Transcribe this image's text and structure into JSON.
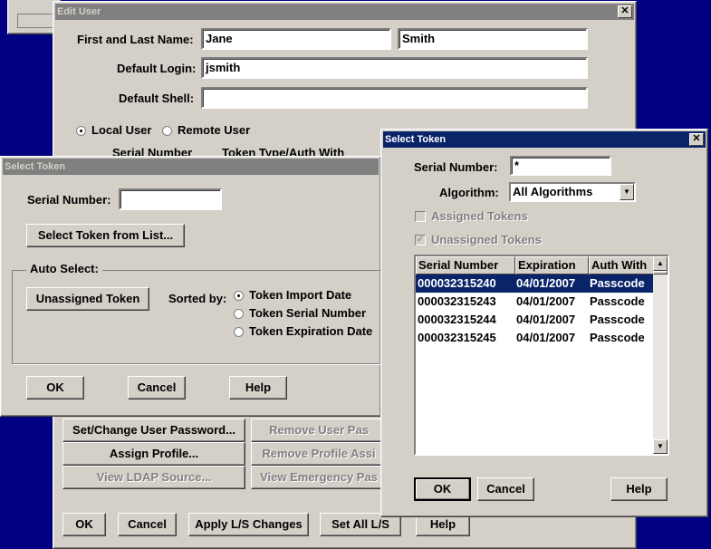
{
  "edit_user": {
    "title": "Edit User",
    "first_last_label": "First and Last Name:",
    "first_name": "Jane",
    "last_name": "Smith",
    "login_label": "Default Login:",
    "login": "jsmith",
    "shell_label": "Default Shell:",
    "shell": "",
    "local_user": "Local User",
    "remote_user": "Remote User",
    "col_serial": "Serial Number",
    "col_token_type": "Token Type/Auth With",
    "set_password": "Set/Change User Password...",
    "remove_user_pass": "Remove User Pas",
    "assign_profile": "Assign Profile...",
    "remove_profile": "Remove Profile Assi",
    "view_ldap": "View LDAP Source...",
    "view_emergency": "View Emergency Pas",
    "ok": "OK",
    "cancel": "Cancel",
    "apply": "Apply L/S Changes",
    "set_all": "Set All L/S",
    "help": "Help"
  },
  "select_token_left": {
    "title": "Select Token",
    "serial_label": "Serial Number:",
    "serial_value": "",
    "select_from_list": "Select Token from List...",
    "auto_select": "Auto Select:",
    "unassigned_token": "Unassigned Token",
    "sorted_by": "Sorted by:",
    "sort_import": "Token Import Date",
    "sort_serial": "Token Serial Number",
    "sort_expiration": "Token Expiration Date",
    "ok": "OK",
    "cancel": "Cancel",
    "help": "Help"
  },
  "select_token_right": {
    "title": "Select Token",
    "serial_label": "Serial Number:",
    "serial_value": "*",
    "algorithm_label": "Algorithm:",
    "algorithm_value": "All Algorithms",
    "assigned_tokens": "Assigned Tokens",
    "unassigned_tokens": "Unassigned Tokens",
    "columns": [
      "Serial Number",
      "Expiration",
      "Auth With"
    ],
    "rows": [
      [
        "000032315240",
        "04/01/2007",
        "Passcode"
      ],
      [
        "000032315243",
        "04/01/2007",
        "Passcode"
      ],
      [
        "000032315244",
        "04/01/2007",
        "Passcode"
      ],
      [
        "000032315245",
        "04/01/2007",
        "Passcode"
      ]
    ],
    "ok": "OK",
    "cancel": "Cancel",
    "help": "Help"
  }
}
